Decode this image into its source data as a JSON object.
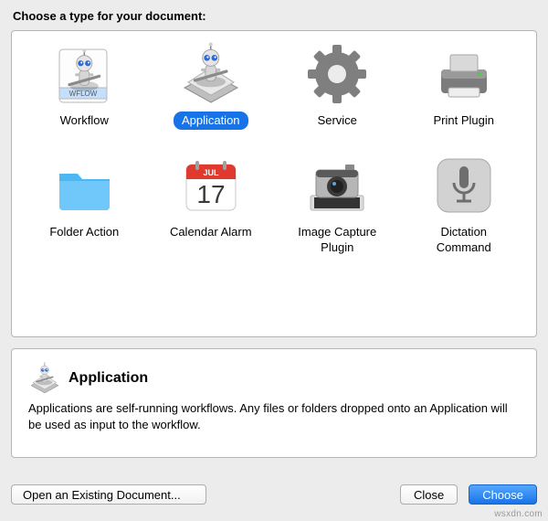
{
  "heading": "Choose a type for your document:",
  "types": [
    {
      "id": "workflow",
      "label": "Workflow",
      "icon": "workflow-icon"
    },
    {
      "id": "application",
      "label": "Application",
      "icon": "application-icon",
      "selected": true
    },
    {
      "id": "service",
      "label": "Service",
      "icon": "service-icon"
    },
    {
      "id": "print-plugin",
      "label": "Print Plugin",
      "icon": "print-plugin-icon"
    },
    {
      "id": "folder-action",
      "label": "Folder Action",
      "icon": "folder-action-icon"
    },
    {
      "id": "calendar-alarm",
      "label": "Calendar Alarm",
      "icon": "calendar-alarm-icon"
    },
    {
      "id": "image-capture",
      "label": "Image Capture\nPlugin",
      "icon": "image-capture-icon"
    },
    {
      "id": "dictation",
      "label": "Dictation\nCommand",
      "icon": "dictation-icon"
    }
  ],
  "description": {
    "title": "Application",
    "body": "Applications are self-running workflows. Any files or folders dropped onto an Application will be used as input to the workflow."
  },
  "buttons": {
    "open_existing": "Open an Existing Document...",
    "close": "Close",
    "choose": "Choose"
  },
  "watermark": "wsxdn.com"
}
